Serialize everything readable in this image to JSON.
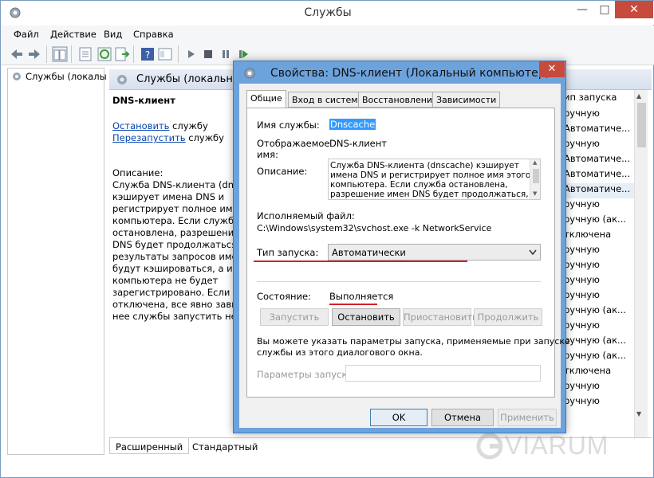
{
  "window": {
    "title": "Службы",
    "minimize": "—",
    "maximize": "□",
    "close": "✕"
  },
  "menu": [
    "Файл",
    "Действие",
    "Вид",
    "Справка"
  ],
  "tree": {
    "root": "Службы (локалы"
  },
  "content": {
    "header": "Службы (локальн",
    "service_name": "DNS-клиент",
    "stop_link": "Остановить",
    "stop_rest": " службу",
    "restart_link": "Перезапустить",
    "restart_rest": " службу",
    "desc_label": "Описание:",
    "desc_lines": [
      "Служба DNS-клиента (dnsca",
      "кэширует имена DNS и",
      "регистрирует полное имя э",
      "компьютера. Если служба",
      "остановлена, разрешение и",
      "DNS будет продолжаться, но",
      "результаты запросов имен D",
      "будут кэшироваться, а имя",
      "компьютера не будет",
      "зарегистрировано. Если слу",
      "отключена, все явно завися",
      "нее службы запустить не уд"
    ],
    "column_header": "ип запуска",
    "rows": [
      "ручную",
      "Автоматиче...",
      "ручную",
      "Автоматиче...",
      "Автоматиче...",
      "Автоматиче...",
      "ручную",
      "ручную (ак...",
      "тключена",
      "ручную",
      "ручную",
      "ручную",
      "ручную",
      "ручную (ак...",
      "ручную",
      "ручную (ак...",
      "ручную (ак...",
      "тключена",
      "ручную",
      "ручную"
    ],
    "tab_extended": "Расширенный",
    "tab_standard": "Стандартный"
  },
  "dialog": {
    "title": "Свойства: DNS-клиент (Локальный компьютер)",
    "close": "✕",
    "tabs": [
      "Общие",
      "Вход в систему",
      "Восстановление",
      "Зависимости"
    ],
    "service_name_label": "Имя службы:",
    "service_name_value": "Dnscache",
    "display_name_label_1": "Отображаемое",
    "display_name_label_2": "имя:",
    "display_name_value": "DNS-клиент",
    "description_label": "Описание:",
    "description_lines": [
      "Служба DNS-клиента (dnscache) кэширует",
      "имена DNS и регистрирует полное имя этого",
      "компьютера. Если служба остановлена,",
      "разрешение имен DNS будет продолжаться, но"
    ],
    "exe_label": "Исполняемый файл:",
    "exe_path": "C:\\Windows\\system32\\svchost.exe -k NetworkService",
    "startup_label": "Тип запуска:",
    "startup_value": "Автоматически",
    "status_label": "Состояние:",
    "status_value": "Выполняется",
    "btn_start": "Запустить",
    "btn_stop": "Остановить",
    "btn_pause": "Приостановить",
    "btn_resume": "Продолжить",
    "hint_line1": "Вы можете указать параметры запуска, применяемые при запуске",
    "hint_line2": "службы из этого диалогового окна.",
    "params_label": "Параметры запуска:",
    "params_value": "",
    "btn_ok": "OK",
    "btn_cancel": "Отмена",
    "btn_apply": "Применить"
  },
  "watermark": "VIARUM",
  "colors": {
    "accent": "#6da3dd",
    "close_red": "#c74b3c",
    "underline_red": "#d41f27",
    "link": "#0645ad",
    "selection": "#3399ff"
  }
}
